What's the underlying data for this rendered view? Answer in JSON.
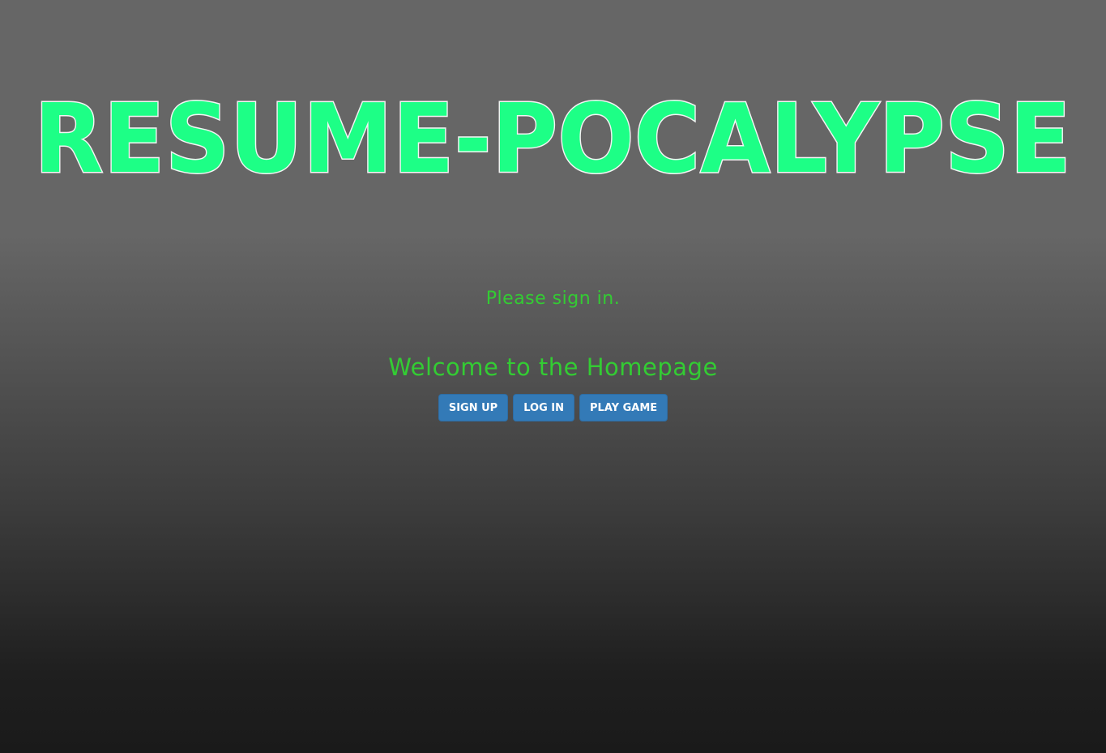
{
  "header": {
    "logo_text": "RESUME-POCALYPSE"
  },
  "main": {
    "status_text": "Please sign in.",
    "welcome_heading": "Welcome to the Homepage",
    "buttons": {
      "sign_up": "SIGN UP",
      "log_in": "LOG IN",
      "play_game": "PLAY GAME"
    }
  },
  "colors": {
    "logo_fill": "#1dff86",
    "logo_outline": "#f4f4f4",
    "text_green": "#33cc33",
    "button_blue": "#337ab7",
    "background_top": "#666666",
    "background_bottom": "#1a1a1a"
  }
}
